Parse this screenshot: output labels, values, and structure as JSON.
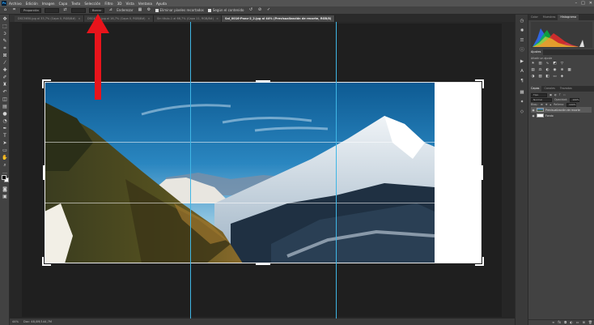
{
  "menubar": {
    "logo": "Ps",
    "items": [
      "Archivo",
      "Edición",
      "Imagen",
      "Capa",
      "Texto",
      "Selección",
      "Filtro",
      "3D",
      "Vista",
      "Ventana",
      "Ayuda"
    ],
    "controls": {
      "minimize": "–",
      "maximize": "□",
      "close": "✕"
    }
  },
  "options": {
    "tool_icon": "crop-icon",
    "ratio_select": "Proporción",
    "width_value": "",
    "swap_icon": "⇄",
    "height_value": "",
    "clear_button": "Borrar",
    "straighten_label": "Enderezar",
    "delete_cropped_label": "Eliminar píxeles recortados",
    "content_aware_label": "Según el contenido",
    "reset_icon": "↺",
    "cancel_icon": "⊘",
    "commit_icon": "✓"
  },
  "tabs": [
    {
      "label": "DSC5650.jpg al 33,7% (Capa 0, RGB/8#)",
      "active": false
    },
    {
      "label": "DSC4243.jpg al 16,7% (Capa 0, RGB/8#)",
      "active": false
    },
    {
      "label": "Sin título-1 al 66,7% (Capa 11, RGB/8#)",
      "active": false
    },
    {
      "label": "Sal_0016-Pano-2_2.jpg al 44% (Previsualización de recorte, RGB/8)",
      "active": true
    }
  ],
  "status": {
    "zoom": "44%",
    "doc": "Doc: 48,0M/144,7M"
  },
  "panels": {
    "top_tabs": [
      "Color",
      "Muestras",
      "Histograma"
    ],
    "adjust_tabs": [
      "Ajustes"
    ],
    "adjust_label": "Añadir un ajuste",
    "layer_tabs": [
      "Capas",
      "Canales",
      "Trazados"
    ],
    "blend_mode": "Normal",
    "opacity_label": "Opacidad:",
    "opacity_value": "100%",
    "lock_label": "Bloq.:",
    "fill_label": "Relleno:",
    "fill_value": "100%",
    "kind_label": "Tipo",
    "layers": [
      {
        "name": "Previsualización de recorte",
        "selected": true
      },
      {
        "name": "Fondo",
        "selected": false
      }
    ]
  },
  "colors": {
    "guide": "#3fb6e5",
    "arrow": "#e8141b",
    "canvas": "#1f1f1f",
    "white_fill": "#ffffff"
  }
}
